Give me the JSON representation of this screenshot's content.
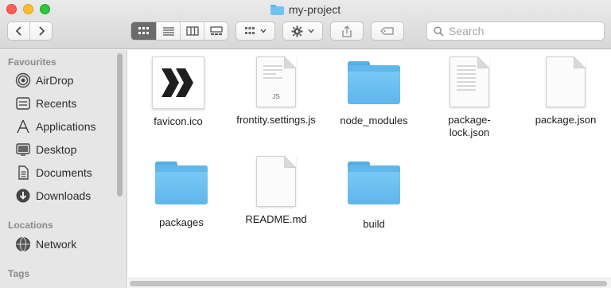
{
  "window": {
    "title": "my-project"
  },
  "toolbar": {
    "view_modes": [
      "icon-view",
      "list-view",
      "column-view",
      "gallery-view"
    ],
    "active_view": "icon-view"
  },
  "search": {
    "placeholder": "Search"
  },
  "sidebar": {
    "favourites_heading": "Favourites",
    "favourites": [
      {
        "label": "AirDrop",
        "icon": "airdrop-icon"
      },
      {
        "label": "Recents",
        "icon": "recents-icon"
      },
      {
        "label": "Applications",
        "icon": "applications-icon"
      },
      {
        "label": "Desktop",
        "icon": "desktop-icon"
      },
      {
        "label": "Documents",
        "icon": "documents-icon"
      },
      {
        "label": "Downloads",
        "icon": "downloads-icon"
      }
    ],
    "locations_heading": "Locations",
    "locations": [
      {
        "label": "Network",
        "icon": "network-icon"
      }
    ],
    "tags_heading": "Tags"
  },
  "files": [
    {
      "name": "favicon.ico",
      "kind": "image"
    },
    {
      "name": "frontity.settings.js",
      "kind": "js",
      "badge": "JS"
    },
    {
      "name": "node_modules",
      "kind": "folder"
    },
    {
      "name": "package-\nlock.json",
      "kind": "doc"
    },
    {
      "name": "package.json",
      "kind": "doc"
    },
    {
      "name": "packages",
      "kind": "folder"
    },
    {
      "name": "README.md",
      "kind": "doc"
    },
    {
      "name": "build",
      "kind": "folder"
    }
  ],
  "colors": {
    "folder": "#6cc3f4",
    "sidebar_bg": "#e7e6e7",
    "close": "#fe5f57",
    "minimize": "#febc2e",
    "maximize": "#28c840"
  }
}
